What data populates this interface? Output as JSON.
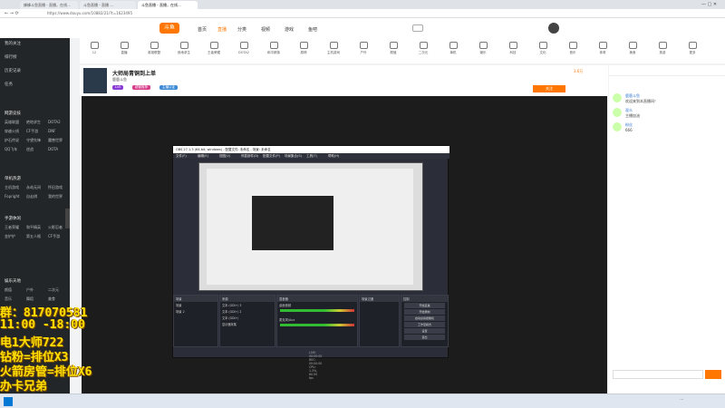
{
  "browser": {
    "tabs": [
      "蜂蜂斗鱼直播 - 直播，在线…",
      "斗鱼直播 - 直播 ...",
      "斗鱼直播 - 直播，在线..."
    ],
    "url": "https://www.douyu.com/10882/21/?t=1623495"
  },
  "site": {
    "nav": [
      "首页",
      "直播",
      "分类",
      "视频",
      "游戏",
      "鱼吧"
    ],
    "pc_badge": "PC客户端"
  },
  "left_sidebar": {
    "top_items": [
      "我的关注",
      "排行榜",
      "历史记录",
      "任务"
    ],
    "sections": [
      {
        "title": "网游竞技",
        "items": [
          "英雄联盟",
          "绝地求生",
          "DOTA2",
          "穿越火线",
          "CF手游",
          "DNF",
          "炉石传说",
          "守望先锋",
          "魔兽世界",
          "QQ飞车",
          "逆战",
          "DOTA"
        ]
      },
      {
        "title": "单机热游",
        "items": [
          "主机游戏",
          "永劫无间",
          "怀旧游戏",
          "Fopright",
          "自走棋",
          "我的世界"
        ]
      },
      {
        "title": "手游休闲",
        "items": [
          "王者荣耀",
          "和平精英",
          "火影忍者",
          "金铲铲",
          "第五人格",
          "CF手游"
        ]
      },
      {
        "title": "娱乐天地",
        "items": [
          "颜值",
          "户外",
          "二次元",
          "音乐",
          "舞蹈",
          "美食"
        ]
      }
    ]
  },
  "categories": [
    "12",
    "直播",
    "英雄联盟",
    "绝地求生",
    "王者荣耀",
    "DOTA2",
    "和平精英",
    "原神",
    "主机游戏",
    "户外",
    "颜值",
    "二次元",
    "单机",
    "娱乐",
    "科技",
    "文化",
    "音乐",
    "体育",
    "美食",
    "旅游",
    "更多"
  ],
  "room": {
    "title": "大师局青铜到上单",
    "streamer": "鹿鹿斗鱼",
    "tags": [
      "Lv5",
      "超管推荐",
      "主播认证"
    ],
    "follow_button": "关注",
    "count": "3.6万"
  },
  "obs": {
    "title": "OBS 27.1.3 (64-bit, windows) - 配置文件: 未命名 - 场景: 未命名",
    "menu": [
      "文件(F)",
      "编辑(E)",
      "视图(V)",
      "停靠部件(D)",
      "配置文件(P)",
      "场景集合(S)",
      "工具(T)",
      "帮助(H)"
    ],
    "panels": [
      "场景",
      "来源",
      "混音器",
      "场景过渡",
      "控制"
    ],
    "scenes": [
      "场景",
      "场景 2"
    ],
    "sources": [
      "文本 (GDI+) 3",
      "文本 (GDI+) 2",
      "文本 (GDI+)",
      "显示器采集"
    ],
    "mixer": [
      "桌面音频",
      "麦克风/Aux"
    ],
    "controls": [
      "开始直播",
      "开始录制",
      "启动虚拟摄像机",
      "工作室模式",
      "设置",
      "退出"
    ],
    "status": "LIVE: 00:00:00  REC: 00:00:00  CPU: 1.3%, 60.00 fps"
  },
  "overlay_text": [
    "群：817070581",
    "11:00 -18:00",
    "电1大师722",
    "钻粉=排位X3",
    "火箭房管=排位X6",
    "办卡兄弟"
  ],
  "chat": {
    "messages": [
      {
        "user": "鹿鹿斗鱼",
        "text": "欢迎来到本直播间！"
      },
      {
        "user": "观众",
        "text": "主播加油"
      },
      {
        "user": "粉丝",
        "text": "666"
      }
    ]
  },
  "colors": {
    "accent": "#ff7700",
    "sidebar_bg": "#232628",
    "overlay": "#ffe000"
  }
}
